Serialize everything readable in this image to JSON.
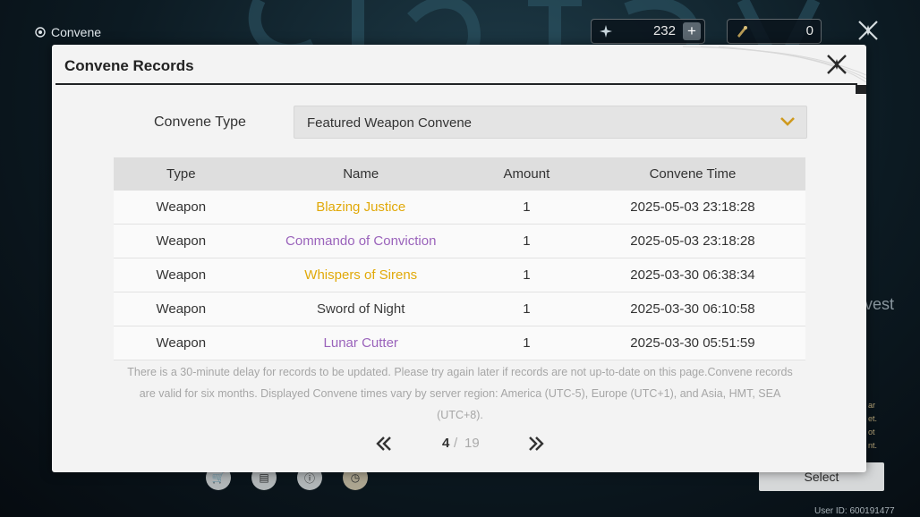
{
  "app": {
    "brand": "Convene",
    "user_id": "User ID: 600191477"
  },
  "currency": [
    {
      "icon": "astrite-icon",
      "value": "232"
    },
    {
      "icon": "forging-tide-icon",
      "value": "0"
    }
  ],
  "background": {
    "side_text": "vest",
    "side_lines": [
      "ar",
      "et.",
      "ot",
      "nt."
    ],
    "select_label": "Select"
  },
  "modal": {
    "title": "Convene Records",
    "type_label": "Convene Type",
    "type_value": "Featured Weapon Convene",
    "columns": [
      "Type",
      "Name",
      "Amount",
      "Convene Time"
    ],
    "rows": [
      {
        "type": "Weapon",
        "name": "Blazing Justice",
        "amount": "1",
        "time": "2025-05-03 23:18:28",
        "rarity_color": "#e1a909"
      },
      {
        "type": "Weapon",
        "name": "Commando of Conviction",
        "amount": "1",
        "time": "2025-05-03 23:18:28",
        "rarity_color": "#9a63bb"
      },
      {
        "type": "Weapon",
        "name": "Whispers of Sirens",
        "amount": "1",
        "time": "2025-03-30 06:38:34",
        "rarity_color": "#e1a909"
      },
      {
        "type": "Weapon",
        "name": "Sword of Night",
        "amount": "1",
        "time": "2025-03-30 06:10:58",
        "rarity_color": "#3b3b3b"
      },
      {
        "type": "Weapon",
        "name": "Lunar Cutter",
        "amount": "1",
        "time": "2025-03-30 05:51:59",
        "rarity_color": "#9a63bb"
      }
    ],
    "notice": "There is a 30-minute delay for records to be updated. Please try again later if records are not up-to-date on this page.Convene records are valid for six months. Displayed Convene times vary by server region: America (UTC-5), Europe (UTC+1), and Asia, HMT, SEA (UTC+8).",
    "pager": {
      "current": "4",
      "separator": "/",
      "total": "19"
    }
  }
}
